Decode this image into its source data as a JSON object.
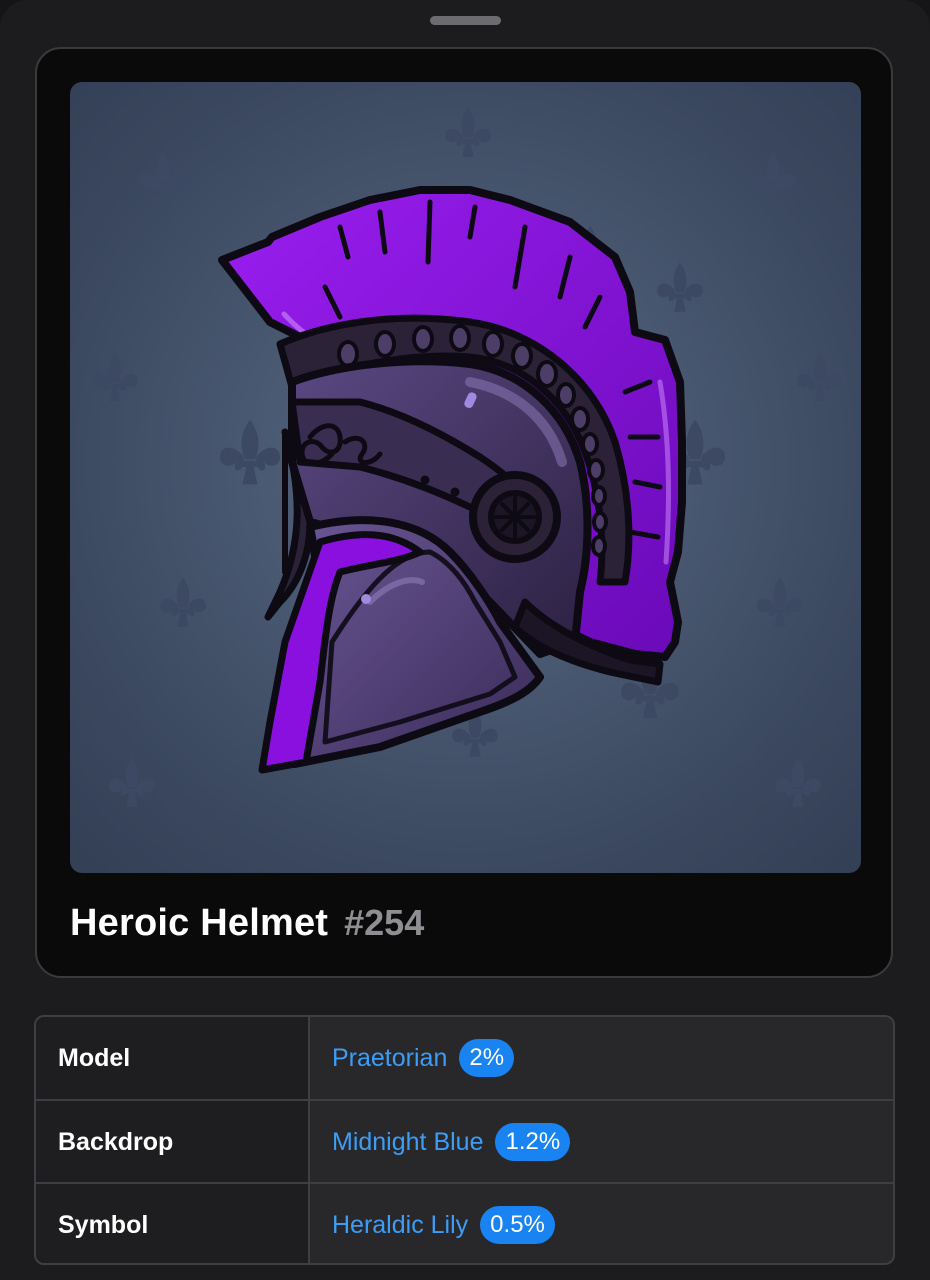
{
  "gift": {
    "name": "Heroic Helmet",
    "number": "#254"
  },
  "attributes": [
    {
      "key": "Model",
      "value": "Praetorian",
      "rarity": "2%"
    },
    {
      "key": "Backdrop",
      "value": "Midnight Blue",
      "rarity": "1.2%"
    },
    {
      "key": "Symbol",
      "value": "Heraldic Lily",
      "rarity": "0.5%"
    }
  ],
  "icons": {
    "artwork": "spartan-helmet-icon",
    "pattern": "fleur-de-lis-icon"
  },
  "colors": {
    "backdrop": "#4a5a72",
    "plume": "#8a10e0",
    "helmet": "#4a3a6e",
    "link": "#3d9df6",
    "badge": "#1983f2"
  }
}
